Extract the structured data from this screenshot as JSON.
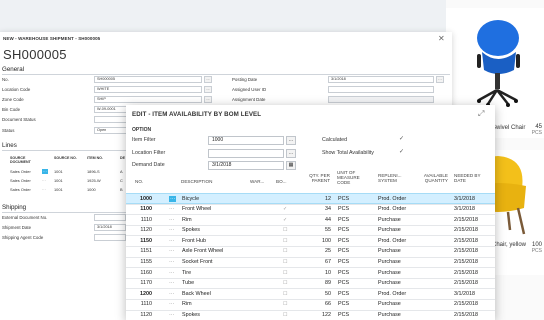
{
  "products": [
    {
      "name": "Swivel Chair",
      "price": "45",
      "unit": "PCS"
    },
    {
      "name": "Chair, yellow",
      "price": "100",
      "unit": "PCS"
    }
  ],
  "shipment": {
    "window_title": "NEW - WAREHOUSE SHIPMENT - SH000005",
    "doc_no": "SH000005",
    "general_label": "General",
    "fields_left": [
      {
        "label": "No.",
        "value": "SH000005"
      },
      {
        "label": "Location Code",
        "value": "WHITE"
      },
      {
        "label": "Zone Code",
        "value": "SHIP"
      },
      {
        "label": "Bin Code",
        "value": "W-09-0001"
      },
      {
        "label": "Document Status",
        "value": ""
      },
      {
        "label": "Status",
        "value": "Open"
      }
    ],
    "fields_right": [
      {
        "label": "Posting Date",
        "value": "3/1/2018"
      },
      {
        "label": "Assigned User ID",
        "value": ""
      },
      {
        "label": "Assignment Date",
        "value": ""
      }
    ],
    "lines_label": "Lines",
    "lines_headers": [
      "SOURCE DOCUMENT",
      "SOURCE NO.",
      "ITEM NO.",
      "DE"
    ],
    "lines": [
      {
        "doc": "Sales Order",
        "no": "1001",
        "item": "1896-S",
        "d": "A"
      },
      {
        "doc": "Sales Order",
        "no": "1001",
        "item": "1925-W",
        "d": "C"
      },
      {
        "doc": "Sales Order",
        "no": "1001",
        "item": "1000",
        "d": "B"
      }
    ],
    "shipping_label": "Shipping",
    "shipping_fields": [
      {
        "label": "External Document No.",
        "value": ""
      },
      {
        "label": "Shipment Date",
        "value": "3/1/2018"
      },
      {
        "label": "Shipping Agent Code",
        "value": ""
      }
    ]
  },
  "modal": {
    "title": "EDIT - ITEM AVAILABILITY BY BOM LEVEL",
    "option_label": "OPTION",
    "item_filter_label": "Item Filter",
    "item_filter_value": "1000",
    "location_filter_label": "Location Filter",
    "location_filter_value": "",
    "demand_date_label": "Demand Date",
    "demand_date_value": "3/1/2018",
    "calculated_label": "Calculated",
    "show_total_label": "Show Total Availability",
    "columns": {
      "no": "NO.",
      "description": "DESCRIPTION",
      "war": "WAR...",
      "bo": "BO...",
      "qty_per_parent": "QTY. PER PARENT",
      "uom": "UNIT OF MEASURE CODE",
      "replenishment": "REPLENI... SYSTEM",
      "available_qty": "AVAILABLE QUANTITY",
      "needed_by": "NEEDED BY DATE"
    },
    "rows": [
      {
        "no": "1000",
        "description": "Bicycle",
        "bo": "",
        "qty": "12",
        "uom": "PCS",
        "system": "Prod. Order",
        "available": "",
        "needed": "3/1/2018"
      },
      {
        "no": "1100",
        "description": "Front Wheel",
        "bo": "✓",
        "qty": "34",
        "uom": "PCS",
        "system": "Prod. Order",
        "available": "",
        "needed": "3/1/2018"
      },
      {
        "no": "1110",
        "description": "Rim",
        "bo": "✓",
        "qty": "44",
        "uom": "PCS",
        "system": "Purchase",
        "available": "",
        "needed": "2/15/2018"
      },
      {
        "no": "1120",
        "description": "Spokes",
        "bo": "☐",
        "qty": "55",
        "uom": "PCS",
        "system": "Purchase",
        "available": "",
        "needed": "2/15/2018"
      },
      {
        "no": "1150",
        "description": "Front Hub",
        "bo": "☐",
        "qty": "100",
        "uom": "PCS",
        "system": "Prod. Order",
        "available": "",
        "needed": "2/15/2018"
      },
      {
        "no": "1151",
        "description": "Axle Front Wheel",
        "bo": "☐",
        "qty": "25",
        "uom": "PCS",
        "system": "Purchase",
        "available": "",
        "needed": "2/15/2018"
      },
      {
        "no": "1155",
        "description": "Socket Front",
        "bo": "☐",
        "qty": "67",
        "uom": "PCS",
        "system": "Purchase",
        "available": "",
        "needed": "2/15/2018"
      },
      {
        "no": "1160",
        "description": "Tire",
        "bo": "☐",
        "qty": "10",
        "uom": "PCS",
        "system": "Purchase",
        "available": "",
        "needed": "2/15/2018"
      },
      {
        "no": "1170",
        "description": "Tube",
        "bo": "☐",
        "qty": "89",
        "uom": "PCS",
        "system": "Purchase",
        "available": "",
        "needed": "2/15/2018"
      },
      {
        "no": "1200",
        "description": "Back Wheel",
        "bo": "☐",
        "qty": "50",
        "uom": "PCS",
        "system": "Prod. Order",
        "available": "",
        "needed": "3/1/2018"
      },
      {
        "no": "1110",
        "description": "Rim",
        "bo": "☐",
        "qty": "66",
        "uom": "PCS",
        "system": "Purchase",
        "available": "",
        "needed": "2/15/2018"
      },
      {
        "no": "1120",
        "description": "Spokes",
        "bo": "☐",
        "qty": "122",
        "uom": "PCS",
        "system": "Purchase",
        "available": "",
        "needed": "2/15/2018"
      }
    ]
  },
  "colors": {
    "accent": "#38b5e8",
    "selected_row": "#d3efff",
    "chair_blue": "#1f6fe0",
    "chair_yellow": "#f3c01a"
  }
}
